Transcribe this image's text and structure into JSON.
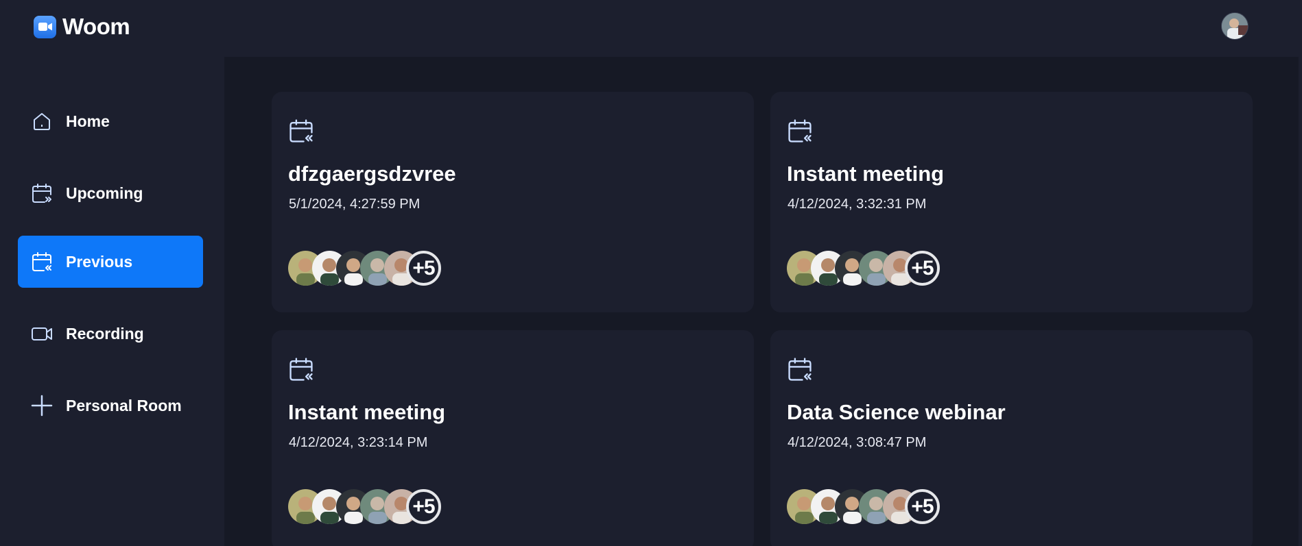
{
  "app": {
    "name": "Woom"
  },
  "sidebar": {
    "items": [
      {
        "label": "Home",
        "icon": "home-icon"
      },
      {
        "label": "Upcoming",
        "icon": "calendar-forward-icon"
      },
      {
        "label": "Previous",
        "icon": "calendar-back-icon",
        "active": true
      },
      {
        "label": "Recording",
        "icon": "video-icon"
      },
      {
        "label": "Personal Room",
        "icon": "plus-icon"
      }
    ]
  },
  "meetings": [
    {
      "title": "dfzgaergsdzvree",
      "date": "5/1/2024, 4:27:59 PM",
      "more": "+5"
    },
    {
      "title": "Instant meeting",
      "date": "4/12/2024, 3:32:31 PM",
      "more": "+5"
    },
    {
      "title": "Instant meeting",
      "date": "4/12/2024, 3:23:14 PM",
      "more": "+5"
    },
    {
      "title": "Data Science webinar",
      "date": "4/12/2024, 3:08:47 PM",
      "more": "+5"
    }
  ],
  "colors": {
    "background": "#161925",
    "panel": "#1c1f2e",
    "accent": "#0e78f9",
    "icon_stroke": "#c9dcff"
  }
}
